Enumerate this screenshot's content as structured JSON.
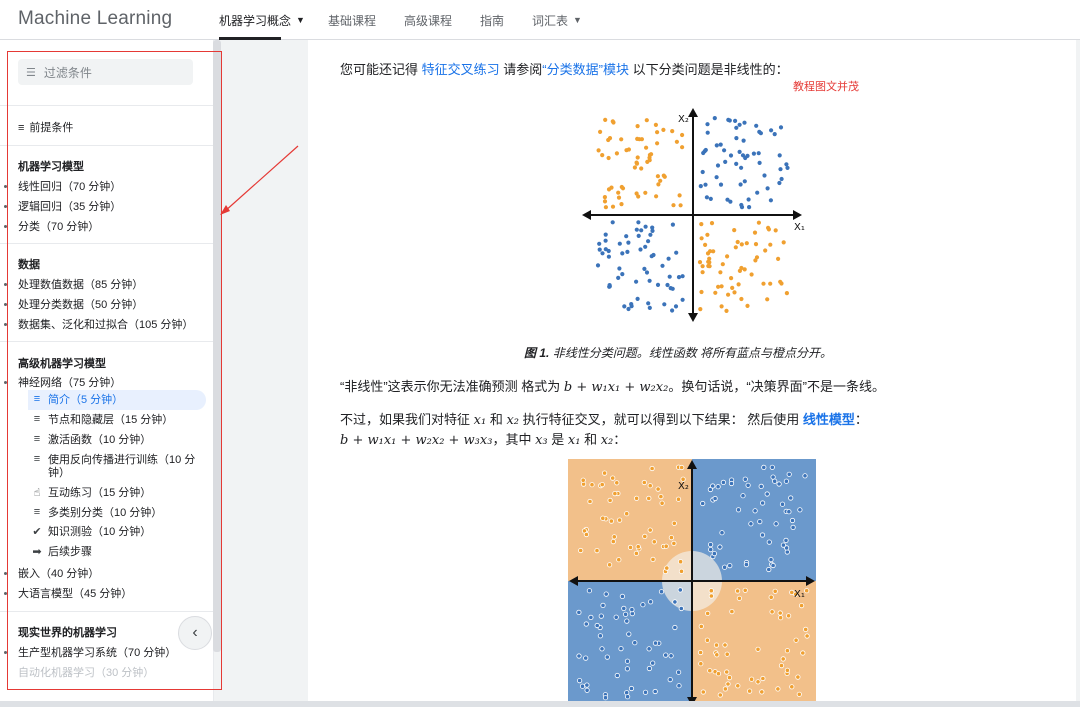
{
  "header": {
    "brand": "Machine Learning",
    "nav": [
      {
        "label": "机器学习概念",
        "caret": true,
        "active": true
      },
      {
        "label": "基础课程",
        "caret": false,
        "active": false
      },
      {
        "label": "高级课程",
        "caret": false,
        "active": false
      },
      {
        "label": "指南",
        "caret": false,
        "active": false
      },
      {
        "label": "词汇表",
        "caret": true,
        "active": false
      }
    ]
  },
  "sidebar": {
    "filter_placeholder": "过滤条件",
    "prereq": "前提条件",
    "sections": [
      {
        "title": "机器学习模型",
        "items": [
          "线性回归（70 分钟）",
          "逻辑回归（35 分钟）",
          "分类（70 分钟）"
        ]
      },
      {
        "title": "数据",
        "items": [
          "处理数值数据（85 分钟）",
          "处理分类数据（50 分钟）",
          "数据集、泛化和过拟合（105 分钟）"
        ]
      },
      {
        "title": "高级机器学习模型",
        "items": [
          "神经网络（75 分钟）"
        ]
      },
      {
        "title": "现实世界的机器学习",
        "items": [
          "生产型机器学习系统（70 分钟）",
          "自动化机器学习（30 分钟）"
        ]
      }
    ],
    "nn_children": [
      {
        "label": "简介（5 分钟）",
        "icon": "lines-icon",
        "active": true
      },
      {
        "label": "节点和隐藏层（15 分钟）",
        "icon": "lines-icon"
      },
      {
        "label": "激活函数（10 分钟）",
        "icon": "lines-icon"
      },
      {
        "label": "使用反向传播进行训练（10 分",
        "label2": "钟）",
        "icon": "lines-icon"
      },
      {
        "label": "互动练习（15 分钟）",
        "icon": "touch-icon"
      },
      {
        "label": "多类别分类（10 分钟）",
        "icon": "lines-icon"
      },
      {
        "label": "知识测验（10 分钟）",
        "icon": "check-icon"
      },
      {
        "label": "后续步骤",
        "icon": "arrow-icon"
      }
    ],
    "after_nn": [
      "嵌入（40 分钟）",
      "大语言模型（45 分钟）"
    ]
  },
  "content": {
    "p1_a": "您可能还记得",
    "p1_link1": "特征交叉练习",
    "p1_b": "请参阅",
    "p1_link2": "“分类数据”模块",
    "p1_c": "以下分类问题是非线性的：",
    "watermark": "教程图文并茂",
    "caption_bold": "图 1.",
    "caption_rest": "非线性分类问题。线性函数 将所有蓝点与橙点分开。",
    "p2_a": "“非线性”这表示你无法准确预测 格式为",
    "p2_formula": "b + w₁x₁ + w₂x₂",
    "p2_b": "。换句话说，“决策界面”不是一条线。",
    "p3_a": "不过，如果我们对特征",
    "p3_x1": "x₁",
    "p3_and": "和",
    "p3_x2": "x₂",
    "p3_b": "执行特征交叉，就可以得到以下结果： 然后使用",
    "p3_link": "线性模型",
    "p3_colon": "：",
    "p4_formula": "b + w₁x₁ + w₂x₂ + w₃x₃",
    "p4_a": "，其中",
    "p4_x3": "x₃",
    "p4_b": "是",
    "p4_x1": "x₁",
    "p4_and": "和",
    "p4_x2": "x₂",
    "p4_colon": "：",
    "axis_x": "X₁",
    "axis_y": "X₂"
  },
  "colors": {
    "blue_point": "#3b73b9",
    "orange_point": "#f0a030",
    "blue_region": "#6b99cc",
    "orange_region": "#f2c08a",
    "highlight_red": "#e53935"
  }
}
